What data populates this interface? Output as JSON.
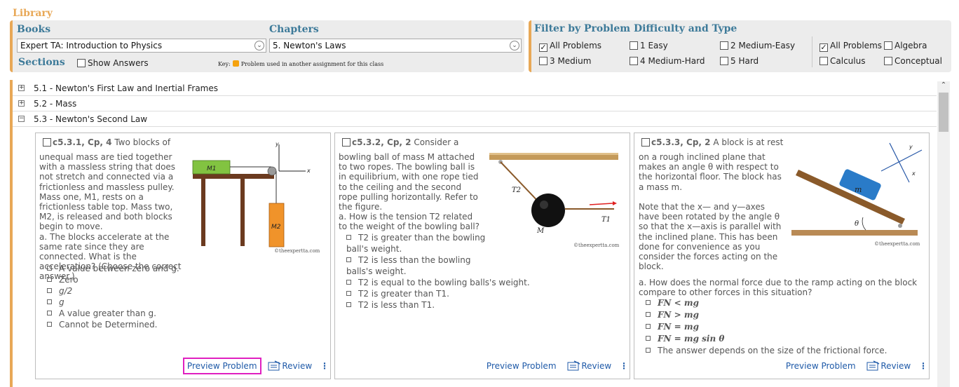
{
  "library_title": "Library",
  "books": {
    "heading": "Books",
    "value": "Expert TA:  Introduction to Physics"
  },
  "chapters": {
    "heading": "Chapters",
    "value": "5. Newton's Laws"
  },
  "sections_heading": "Sections",
  "show_answers": "Show Answers",
  "key": {
    "label": "Key:",
    "text": "Problem used in another assignment for this class",
    "color": "#f5a20e"
  },
  "filter": {
    "heading": "Filter by Problem Difficulty and Type",
    "difficulty": [
      {
        "label": "All Problems",
        "checked": true
      },
      {
        "label": "1 Easy",
        "checked": false
      },
      {
        "label": "2 Medium-Easy",
        "checked": false
      },
      {
        "label": "3 Medium",
        "checked": false
      },
      {
        "label": "4 Medium-Hard",
        "checked": false
      },
      {
        "label": "5 Hard",
        "checked": false
      }
    ],
    "type": [
      {
        "label": "All Problems",
        "checked": true
      },
      {
        "label": "Algebra",
        "checked": false
      },
      {
        "label": "Calculus",
        "checked": false
      },
      {
        "label": "Conceptual",
        "checked": false
      }
    ]
  },
  "sections": [
    {
      "label": "5.1 - Newton's First Law and Inertial Frames",
      "expanded": false
    },
    {
      "label": "5.2 - Mass",
      "expanded": false
    },
    {
      "label": "5.3 - Newton's Second Law",
      "expanded": true
    }
  ],
  "problems": [
    {
      "id": "c5.3.1, Cp, 4",
      "lead": "Two blocks of",
      "body": "unequal mass are tied together with a massless string that does not stretch and connected via a frictionless and massless pulley. Mass one, M1, rests on a frictionless table top. Mass two, M2, is released and both blocks begin to move.",
      "question": "a. The blocks accelerate at the same rate since they are connected. What is the acceleration? (Choose the correct answer.)",
      "choices": [
        "A value between zero and g.",
        "Zero",
        "g/2",
        "g",
        "A value greater than g.",
        "Cannot be Determined."
      ],
      "copyright": "©theexpertta.com",
      "labels": {
        "m1": "M1",
        "m2": "M2",
        "y": "y",
        "x": "x"
      }
    },
    {
      "id": "c5.3.2, Cp, 2",
      "lead": "Consider a",
      "body": "bowling ball of mass M attached to two ropes. The bowling ball is in equilibrium, with one rope tied to the ceiling and the second rope pulling horizontally. Refer to the figure.",
      "question": "a. How is the tension T2 related to the weight of the bowling ball?",
      "choices": [
        "T2 is greater than the bowling ball's weight.",
        "T2 is less than the bowling balls's weight.",
        "T2 is equal to the bowling balls's weight.",
        "T2 is greater than T1.",
        "T2 is less than T1."
      ],
      "copyright": "©theexpertta.com",
      "labels": {
        "t2": "T2",
        "t1": "T1",
        "m": "M"
      }
    },
    {
      "id": "c5.3.3, Cp, 2",
      "lead": "A block is at rest",
      "body": "on a rough inclined plane that makes an angle θ with respect to the horizontal floor. The block has a mass m.",
      "note": "Note that the x— and y—axes have been rotated by the angle θ so that the x—axis is parallel with the inclined plane. This has been done for convenience as you consider the forces acting on the block.",
      "question": "a. How does the normal force due to the ramp acting on the block compare to other forces in this situation?",
      "choices": [
        "FN < mg",
        "FN > mg",
        "FN = mg",
        "FN = mg sin θ",
        "The answer depends on the size of the frictional force."
      ],
      "copyright": "©theexpertta.com",
      "labels": {
        "m": "m",
        "theta": "θ",
        "y": "y",
        "x": "x"
      }
    }
  ],
  "actions": {
    "preview": "Preview Problem",
    "review": "Review",
    "more": "⋮"
  }
}
